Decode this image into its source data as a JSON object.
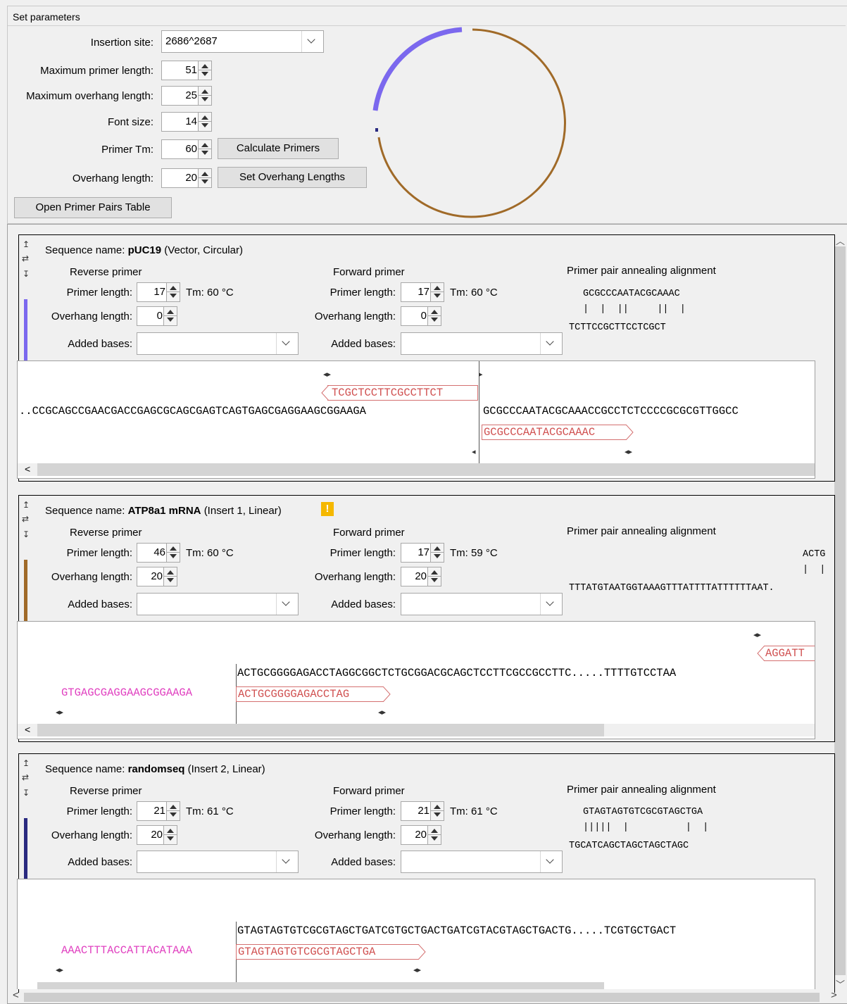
{
  "group_title": "Set parameters",
  "params": {
    "insertion_site_label": "Insertion site:",
    "insertion_site_value": "2686^2687",
    "max_primer_length_label": "Maximum primer length:",
    "max_primer_length_value": "51",
    "max_overhang_length_label": "Maximum overhang length:",
    "max_overhang_length_value": "25",
    "font_size_label": "Font size:",
    "font_size_value": "14",
    "primer_tm_label": "Primer Tm:",
    "primer_tm_value": "60",
    "overhang_length_label": "Overhang length:",
    "overhang_length_value": "20",
    "calculate_button": "Calculate Primers",
    "set_overhang_button": "Set Overhang Lengths",
    "open_table_button": "Open Primer Pairs Table"
  },
  "plasmid_map": {
    "segments": [
      {
        "name": "vector",
        "color": "#a06a28"
      },
      {
        "name": "insert1",
        "color": "#7b68ee"
      },
      {
        "name": "insert2",
        "color": "#2a2a80"
      }
    ]
  },
  "labels": {
    "seq_name_prefix": "Sequence name:",
    "reverse_primer": "Reverse primer",
    "forward_primer": "Forward primer",
    "primer_length": "Primer length:",
    "overhang_length": "Overhang length:",
    "added_bases": "Added bases:",
    "alignment_title": "Primer pair annealing alignment"
  },
  "sequences": [
    {
      "name": "pUC19",
      "info": "(Vector, Circular)",
      "color": "#7b68ee",
      "reverse": {
        "primer_length": "17",
        "tm": "Tm: 60 °C",
        "overhang": "0"
      },
      "forward": {
        "primer_length": "17",
        "tm": "Tm: 60 °C",
        "overhang": "0"
      },
      "alignment": {
        "top": "GCGCCCAATACGCAAAC",
        "bars": "|  |  ||     ||  |",
        "bottom": "TCTTCCGCTTCCTCGCT"
      },
      "rev_primer_seq": "TCGCTCCTTCGCCTTCT",
      "seq_left": "..CCGCAGCCGAACGACCGAGCGCAGCGAGTCAGTGAGCGAGGAAGCGGAAGA",
      "seq_right": "GCGCCCAATACGCAAACCGCCTCTCCCCGCGCGTTGGCC",
      "fwd_primer_seq": "GCGCCCAATACGCAAAC"
    },
    {
      "name": "ATP8a1 mRNA",
      "info": "(Insert 1, Linear)",
      "warning": "!",
      "color": "#a06a28",
      "reverse": {
        "primer_length": "46",
        "tm": "Tm: 60 °C",
        "overhang": "20"
      },
      "forward": {
        "primer_length": "17",
        "tm": "Tm: 59 °C",
        "overhang": "20"
      },
      "alignment": {
        "top": "ACTG",
        "bars": "|  |",
        "bottom": "TTTATGTAATGGTAAAGTTTATTTTATTTTTTAAT."
      },
      "rev_primer_seq": "AGGATT",
      "sequence": "ACTGCGGGGAGACCTAGGCGGCTCTGCGGACGCAGCTCCTTCGCCGCCTTC.....TTTTGTCCTAA",
      "overhang_seq": "GTGAGCGAGGAAGCGGAAGA",
      "fwd_primer_seq": "ACTGCGGGGAGACCTAG"
    },
    {
      "name": "randomseq",
      "info": "(Insert 2, Linear)",
      "color": "#2a2a80",
      "reverse": {
        "primer_length": "21",
        "tm": "Tm: 61 °C",
        "overhang": "20"
      },
      "forward": {
        "primer_length": "21",
        "tm": "Tm: 61 °C",
        "overhang": "20"
      },
      "alignment": {
        "top": "GTAGTAGTGTCGCGTAGCTGA",
        "bars": "|||||  |          |  |",
        "bottom": "TGCATCAGCTAGCTAGCTAGC"
      },
      "sequence": "GTAGTAGTGTCGCGTAGCTGATCGTGCTGACTGATCGTACGTAGCTGACTG.....TCGTGCTGACT",
      "overhang_seq": "AAACTTTACCATTACATAAA",
      "fwd_primer_seq": "GTAGTAGTGTCGCGTAGCTGA"
    }
  ]
}
